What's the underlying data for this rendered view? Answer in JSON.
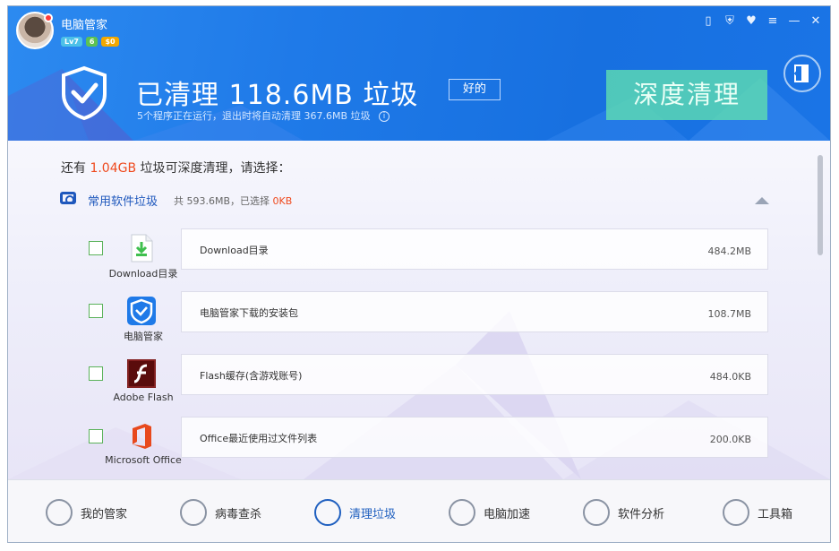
{
  "window": {
    "app_title": "电脑管家",
    "badges": {
      "level": "Lv7",
      "vip": "6",
      "coin": "$0"
    }
  },
  "header": {
    "main_title": "已清理 118.6MB 垃圾",
    "rating": "好的",
    "sub_line": "5个程序正在运行，退出时将自动清理 367.6MB 垃圾",
    "deep_clean_label": "深度清理"
  },
  "content": {
    "prompt_prefix": "还有 ",
    "prompt_size": "1.04GB",
    "prompt_suffix": " 垃圾可深度清理，请选择：",
    "category": {
      "name": "常用软件垃圾",
      "total_prefix": "共 593.6MB，已选择 ",
      "selected": "0KB"
    },
    "items": [
      {
        "app": "Download目录",
        "name": "Download目录",
        "size": "484.2MB",
        "icon": "download-folder-icon"
      },
      {
        "app": "电脑管家",
        "name": "电脑管家下载的安装包",
        "size": "108.7MB",
        "icon": "pc-manager-icon"
      },
      {
        "app": "Adobe Flash",
        "name": "Flash缓存(含游戏账号)",
        "size": "484.0KB",
        "icon": "flash-icon"
      },
      {
        "app": "Microsoft Office",
        "name": "Office最近使用过文件列表",
        "size": "200.0KB",
        "icon": "office-icon"
      }
    ]
  },
  "nav": [
    {
      "label": "我的管家",
      "icon": "butler-icon",
      "active": false
    },
    {
      "label": "病毒查杀",
      "icon": "virus-scan-icon",
      "active": false
    },
    {
      "label": "清理垃圾",
      "icon": "vacuum-icon",
      "active": true
    },
    {
      "label": "电脑加速",
      "icon": "rocket-icon",
      "active": false
    },
    {
      "label": "软件分析",
      "icon": "analysis-icon",
      "active": false
    },
    {
      "label": "工具箱",
      "icon": "toolbox-icon",
      "active": false
    }
  ],
  "colors": {
    "accent": "#1f7ae8",
    "highlight": "#ef4b1f",
    "deep_clean": "#60e0af"
  }
}
